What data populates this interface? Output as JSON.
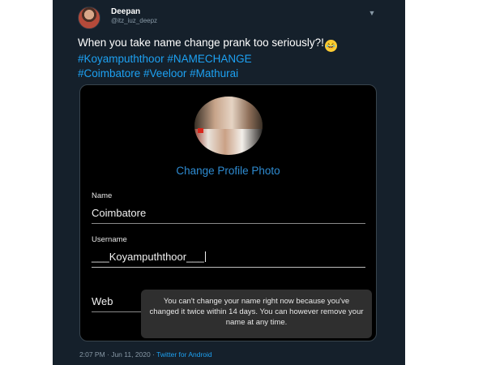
{
  "tweet": {
    "display_name": "Deepan",
    "handle": "@itz_iuz_deepz",
    "text": "When you take name change prank too seriously?!",
    "emoji": "😂",
    "hashtags_line1": "#Koyampuththoor #NAMECHANGE",
    "hashtags_line2": "#Coimbatore #Veeloor #Mathurai",
    "timestamp": "2:07 PM · Jun 11, 2020 · ",
    "source": "Twitter for Android",
    "caret_icon": "chevron-down-icon"
  },
  "media": {
    "change_photo_label": "Change Profile Photo",
    "name_label": "Name",
    "name_value": "Coimbatore",
    "username_label": "Username",
    "username_value": "___Koyampuththoor___",
    "website_value_partial": "Web",
    "toast_text": "You can't change your name right now because you've changed it twice within 14 days. You can however remove your name at any time."
  },
  "colors": {
    "tweet_bg": "#15202b",
    "link_blue": "#1da1f2",
    "instagram_blue": "#2e8bd1",
    "toast_bg": "#2f2f2f"
  }
}
